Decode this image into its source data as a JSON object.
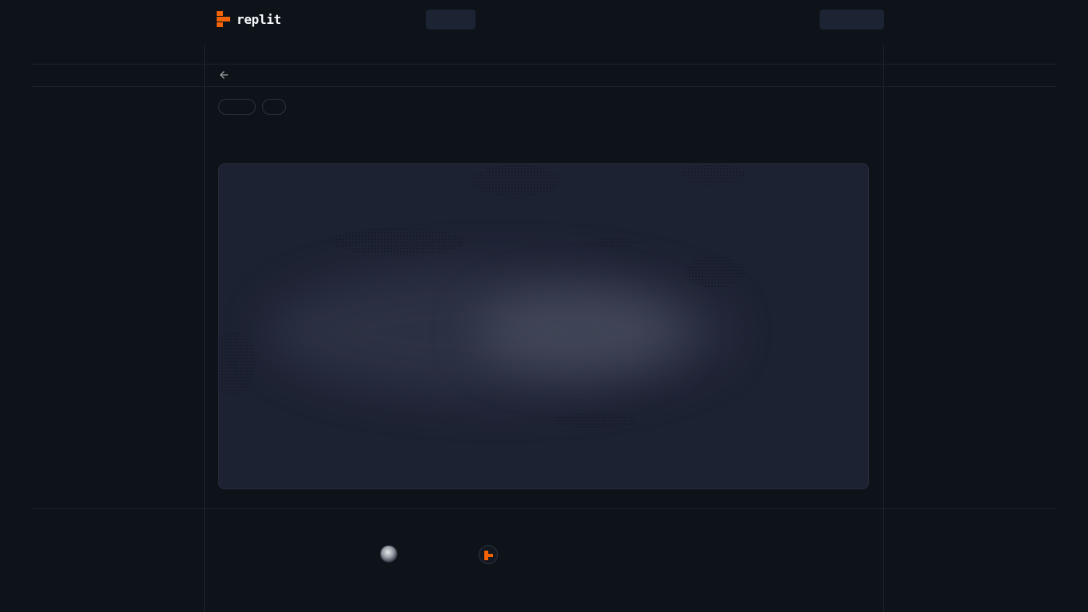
{
  "header": {
    "brand": "replit",
    "logo_icon": "replit-logo-icon",
    "brand_color": "#f26207"
  },
  "nav": {
    "back_icon": "arrow-left-icon"
  },
  "cover": {
    "background_color": "#1d2233"
  },
  "footer": {
    "author_avatar_icon": "avatar-icon",
    "replit_badge_icon": "replit-logo-icon"
  }
}
